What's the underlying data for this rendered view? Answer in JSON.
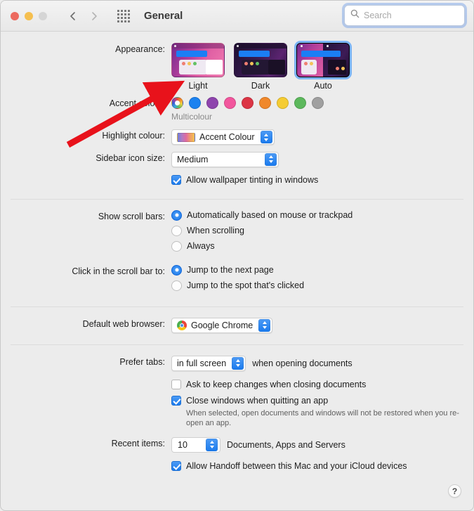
{
  "window": {
    "title": "General",
    "traffic_lights": [
      "close",
      "minimize",
      "zoom"
    ],
    "nav_back": "back-chevron",
    "nav_forward": "forward-chevron",
    "grid_button": "show-all-grid-icon"
  },
  "search": {
    "placeholder": "Search",
    "icon": "search-icon",
    "value": ""
  },
  "appearance": {
    "label": "Appearance:",
    "options": [
      {
        "id": "light",
        "label": "Light",
        "selected": false
      },
      {
        "id": "dark",
        "label": "Dark",
        "selected": false
      },
      {
        "id": "auto",
        "label": "Auto",
        "selected": true
      }
    ]
  },
  "accent": {
    "label": "Accent colour:",
    "selected_name": "Multicolour",
    "swatches": [
      {
        "name": "Multicolour",
        "color": "multi"
      },
      {
        "name": "Blue",
        "color": "#1b82f0"
      },
      {
        "name": "Purple",
        "color": "#8e44ad"
      },
      {
        "name": "Pink",
        "color": "#f2569d"
      },
      {
        "name": "Red",
        "color": "#dc3545"
      },
      {
        "name": "Orange",
        "color": "#f0882b"
      },
      {
        "name": "Yellow",
        "color": "#f5cc33"
      },
      {
        "name": "Green",
        "color": "#5cb85c"
      },
      {
        "name": "Graphite",
        "color": "#a0a0a0"
      }
    ]
  },
  "highlight": {
    "label": "Highlight colour:",
    "value": "Accent Colour",
    "swatch_gradient": "#6f7fd6,#e06aa0,#f3c24f"
  },
  "sidebar_icon_size": {
    "label": "Sidebar icon size:",
    "value": "Medium"
  },
  "wallpaper_tinting": {
    "label": "Allow wallpaper tinting in windows",
    "checked": true
  },
  "scroll_bars": {
    "label": "Show scroll bars:",
    "options": [
      {
        "label": "Automatically based on mouse or trackpad",
        "selected": true
      },
      {
        "label": "When scrolling",
        "selected": false
      },
      {
        "label": "Always",
        "selected": false
      }
    ]
  },
  "scroll_bar_click": {
    "label": "Click in the scroll bar to:",
    "options": [
      {
        "label": "Jump to the next page",
        "selected": true
      },
      {
        "label": "Jump to the spot that's clicked",
        "selected": false
      }
    ]
  },
  "default_browser": {
    "label": "Default web browser:",
    "value": "Google Chrome",
    "icon": "chrome-icon"
  },
  "prefer_tabs": {
    "label": "Prefer tabs:",
    "value": "in full screen",
    "suffix": "when opening documents"
  },
  "ask_keep_changes": {
    "label": "Ask to keep changes when closing documents",
    "checked": false
  },
  "close_windows": {
    "label": "Close windows when quitting an app",
    "checked": true,
    "hint": "When selected, open documents and windows will not be restored when you re-open an app."
  },
  "recent_items": {
    "label": "Recent items:",
    "value": "10",
    "suffix": "Documents, Apps and Servers"
  },
  "handoff": {
    "label": "Allow Handoff between this Mac and your iCloud devices",
    "checked": true
  },
  "help": {
    "label": "?"
  },
  "annotation": {
    "type": "red-arrow",
    "color": "#e8121b"
  }
}
